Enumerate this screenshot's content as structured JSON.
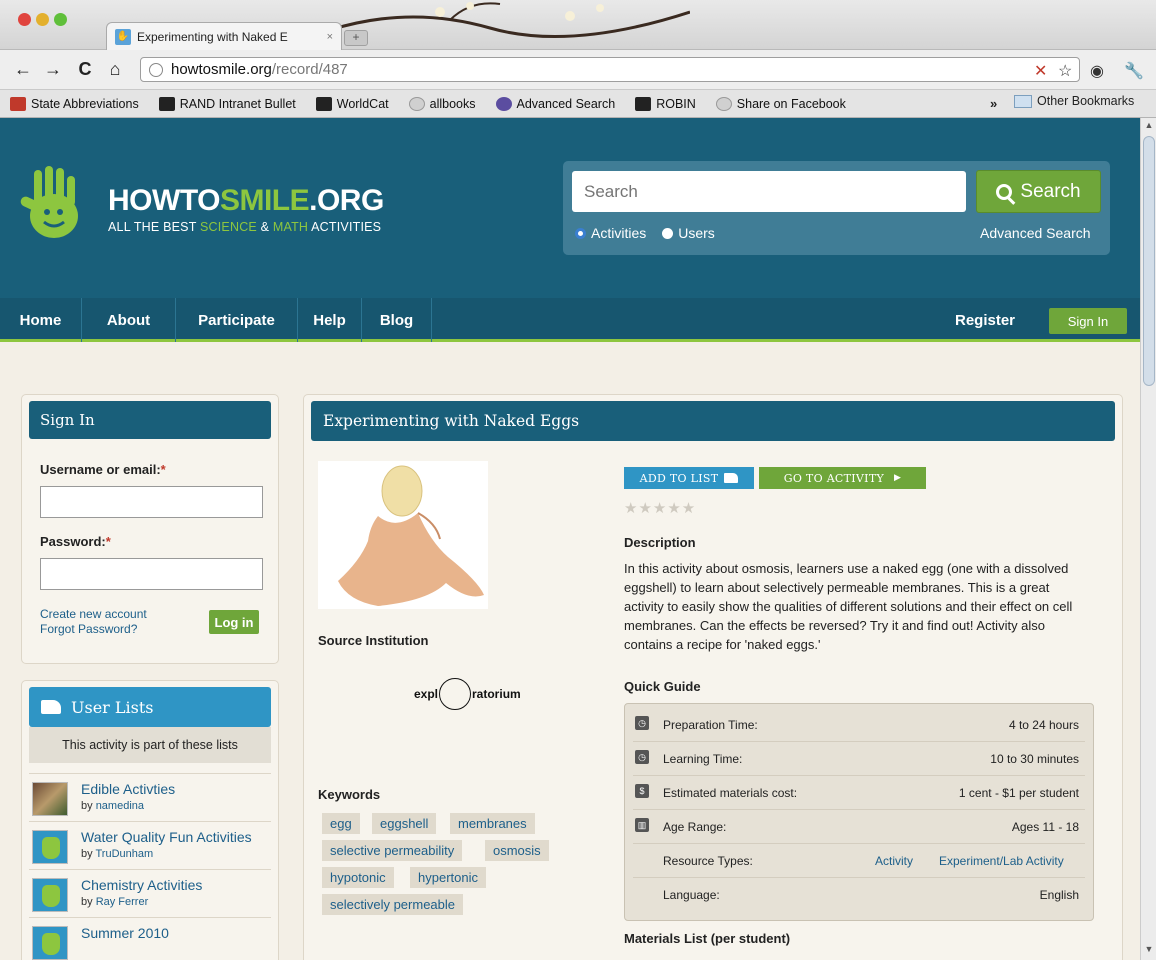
{
  "browser": {
    "tab_title": "Experimenting with Naked E",
    "tab_close": "×",
    "newtab": "+",
    "url_host": "howtosmile.org",
    "url_path": "/record/487",
    "bookmarks": [
      {
        "label": "State Abbreviations",
        "icon": "ap"
      },
      {
        "label": "RAND Intranet Bullet",
        "icon": "rand"
      },
      {
        "label": "WorldCat",
        "icon": "rand"
      },
      {
        "label": "allbooks",
        "icon": "globe"
      },
      {
        "label": "Advanced Search",
        "icon": "adv"
      },
      {
        "label": "ROBIN",
        "icon": "rand"
      },
      {
        "label": "Share on Facebook",
        "icon": "globe"
      }
    ],
    "bookmarks_more": "»",
    "other_bookmarks": "Other Bookmarks"
  },
  "header": {
    "logo_how": "HOWTO",
    "logo_smile": "SMILE",
    "logo_org": ".ORG",
    "tag_1": "ALL THE BEST ",
    "tag_science": "SCIENCE",
    "tag_amp": " & ",
    "tag_math": "MATH",
    "tag_2": " ACTIVITIES",
    "search_placeholder": "Search",
    "search_button": "Search",
    "radio_activities": "Activities",
    "radio_users": "Users",
    "advanced_search": "Advanced Search"
  },
  "nav": {
    "items": [
      "Home",
      "About",
      "Participate",
      "Help",
      "Blog"
    ],
    "register": "Register",
    "sign_in": "Sign In"
  },
  "signin_panel": {
    "title": "Sign In",
    "username_label": "Username or email:",
    "password_label": "Password:",
    "required_mark": "*",
    "create_account": "Create new account",
    "forgot_password": "Forgot Password?",
    "login_button": "Log in"
  },
  "user_lists": {
    "title": "User Lists",
    "subtitle": "This activity is part of these lists",
    "by_prefix": "by ",
    "items": [
      {
        "title": "Edible Activties",
        "user": "namedina"
      },
      {
        "title": "Water Quality Fun Activities",
        "user": "TruDunham"
      },
      {
        "title": "Chemistry Activities",
        "user": "Ray Ferrer"
      },
      {
        "title": "Summer 2010",
        "user": ""
      }
    ]
  },
  "activity": {
    "title": "Experimenting with Naked Eggs",
    "add_to_list": "ADD TO LIST",
    "go_to_activity": "GO TO ACTIVITY",
    "rating_stars": "★★★★★",
    "source_label": "Source Institution",
    "source_left": "expl",
    "source_right": "ratorium",
    "keywords_label": "Keywords",
    "keywords": [
      "egg",
      "eggshell",
      "membranes",
      "selective permeability",
      "osmosis",
      "hypotonic",
      "hypertonic",
      "selectively permeable"
    ],
    "description_label": "Description",
    "description": "In this activity about osmosis, learners use a naked egg (one with a dissolved eggshell) to learn about selectively permeable membranes. This is a great activity to easily show the qualities of different solutions and their effect on cell membranes. Can the effects be reversed? Try it and find out! Activity also contains a recipe for 'naked eggs.'",
    "quick_guide_label": "Quick Guide",
    "quick_guide": {
      "prep_label": "Preparation Time:",
      "prep_value": "4 to 24 hours",
      "learn_label": "Learning Time:",
      "learn_value": "10 to 30 minutes",
      "cost_label": "Estimated materials cost:",
      "cost_value": "1 cent - $1 per student",
      "age_label": "Age Range:",
      "age_value": "Ages 11 - 18",
      "types_label": "Resource Types:",
      "type_1": "Activity",
      "type_2": "Experiment/Lab Activity",
      "lang_label": "Language:",
      "lang_value": "English"
    },
    "materials_label": "Materials List (per student)"
  },
  "colors": {
    "header_blue": "#195f7a",
    "accent_green": "#8dc63f",
    "button_green": "#6fa63a",
    "list_blue": "#2f95c5"
  }
}
